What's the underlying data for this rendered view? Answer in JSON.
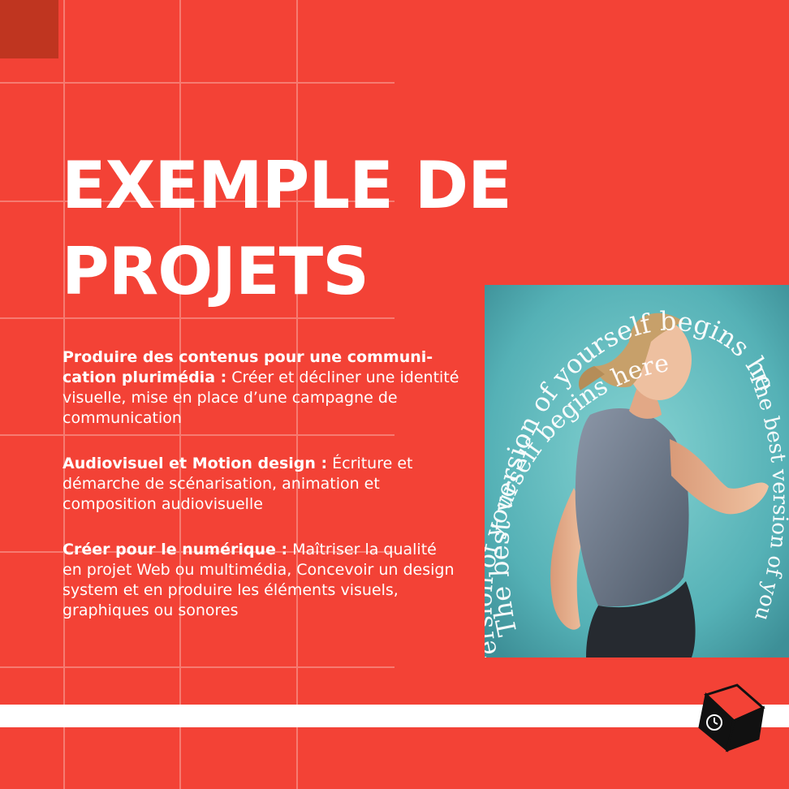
{
  "colors": {
    "background": "#f34236",
    "corner_square": "#bf3520",
    "text": "#ffffff",
    "grid_line": "#f78a80",
    "photo_bg": "#5cb8bc"
  },
  "title": {
    "line1": "EXEMPLE DE",
    "line2": "PROJETS"
  },
  "sections": [
    {
      "lead": "Produire des contenus pour une communi-cation plurimédia :",
      "body": " Créer et décliner une identité visuelle, mise en place d’une campagne de communication"
    },
    {
      "lead": "Audiovisuel et Motion design :",
      "body": " Écriture et démarche de scénarisation, animation et composition audiovisuelle"
    },
    {
      "lead": "Créer pour le numérique :",
      "body": " Maîtriser la qualité en projet Web ou multimédia, Concevoir un design system et en produire les éléments visuels, graphiques ou sonores"
    }
  ],
  "photo": {
    "spiral_outer": "The best version of yourself begins here",
    "spiral_inner": "version of yourself begins here",
    "spiral_right": "The best version of you"
  },
  "icons": {
    "logo": "cube-logo-icon"
  }
}
